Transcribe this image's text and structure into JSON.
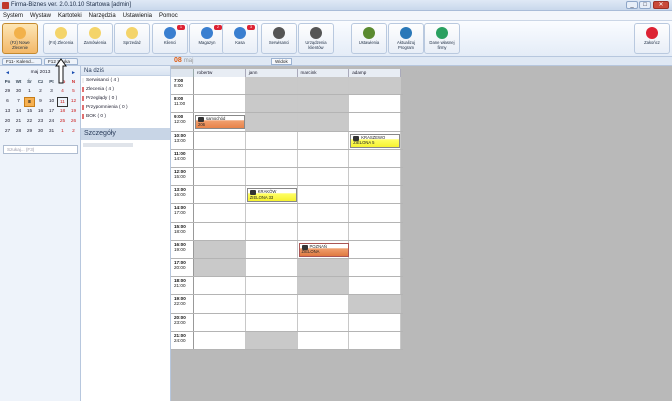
{
  "window": {
    "title": "Firma-Biznes ver. 2.0.10.10 Startowa [admin]",
    "min": "_",
    "max": "□",
    "close": "✕"
  },
  "menu": [
    "System",
    "Wystaw",
    "Kartoteki",
    "Narzędzia",
    "Ustawienia",
    "Pomoc"
  ],
  "toolbar": {
    "buttons": [
      {
        "label": "(F2) Nowe Zlecenie",
        "icon": "new-order-icon",
        "color": "#f2b14a"
      },
      {
        "label": "(F4) Zlecenia",
        "icon": "orders-icon",
        "color": "#f4d46a"
      },
      {
        "label": "Zamówienia",
        "icon": "purchase-icon",
        "color": "#f4d46a"
      },
      {
        "label": "Sprzedaż",
        "icon": "sales-icon",
        "color": "#f4d46a"
      },
      {
        "label": "Klienci",
        "icon": "clients-icon",
        "color": "#3a7fd0"
      },
      {
        "label": "Magazyn",
        "icon": "warehouse-icon",
        "color": "#3a7fd0"
      },
      {
        "label": "Kasa",
        "icon": "cash-icon",
        "color": "#3a7fd0"
      },
      {
        "label": "Serwisanci",
        "icon": "technicians-icon",
        "color": "#555"
      },
      {
        "label": "Urządzenia klientów",
        "icon": "devices-icon",
        "color": "#555"
      },
      {
        "label": "Ustawienia",
        "icon": "settings-icon",
        "color": "#5a8a30"
      },
      {
        "label": "Aktualizuj Program",
        "icon": "update-icon",
        "color": "#2a78b8"
      },
      {
        "label": "Dane własnej firmy",
        "icon": "company-icon",
        "color": "#2aa060"
      },
      {
        "label": "Zakończ",
        "icon": "exit-icon",
        "color": "#d23"
      }
    ],
    "badges": [
      "1",
      "2",
      "3"
    ]
  },
  "tabs": {
    "calendar": "F11- Kalend...",
    "search": "F12 Szuka",
    "date": "08",
    "month": "maj",
    "widok": "Widok"
  },
  "calendar": {
    "month_year": "maj 2013",
    "prev": "◄",
    "next": "►",
    "day_names": [
      "Pn",
      "Wt",
      "Śr",
      "Cz",
      "Pt",
      "So",
      "N"
    ],
    "days": [
      "29",
      "30",
      "1",
      "2",
      "3",
      "4",
      "5",
      "6",
      "7",
      "8",
      "9",
      "10",
      "11",
      "12",
      "13",
      "14",
      "15",
      "16",
      "17",
      "18",
      "19",
      "20",
      "21",
      "22",
      "23",
      "24",
      "25",
      "26",
      "27",
      "28",
      "29",
      "30",
      "31",
      "1",
      "2"
    ],
    "today": "8"
  },
  "search": {
    "placeholder": "Szukaj... (F3)"
  },
  "stats": {
    "title": "Na dziś",
    "items": [
      {
        "label": "Serwisanci ( 4 )",
        "color": "#f0f0f0"
      },
      {
        "label": "Zlecenia ( 4 )",
        "color": "#e07070"
      },
      {
        "label": "Przeglądy ( 0 )",
        "color": "#e07070"
      },
      {
        "label": "Przypomnienia ( 0 )",
        "color": "#e07070"
      },
      {
        "label": "BOK ( 0 )",
        "color": "#e07070"
      }
    ],
    "details": "Szczegóły"
  },
  "schedule": {
    "technicians": [
      "robertw",
      "jann",
      "marcink",
      "adamp"
    ],
    "hours": [
      {
        "start": "7:00",
        "end": "8:00",
        "off": [
          1,
          2,
          3
        ]
      },
      {
        "start": "8:00",
        "end": "11:00",
        "off": [
          1,
          2
        ]
      },
      {
        "start": "9:00",
        "end": "12:00",
        "off": [
          1,
          2
        ]
      },
      {
        "start": "10:00",
        "end": "13:00",
        "off": []
      },
      {
        "start": "11:00",
        "end": "14:00",
        "off": []
      },
      {
        "start": "12:00",
        "end": "15:00",
        "off": []
      },
      {
        "start": "13:00",
        "end": "16:00",
        "off": []
      },
      {
        "start": "14:00",
        "end": "17:00",
        "off": []
      },
      {
        "start": "15:00",
        "end": "18:00",
        "off": []
      },
      {
        "start": "16:00",
        "end": "19:00",
        "off": [
          0
        ]
      },
      {
        "start": "17:00",
        "end": "20:00",
        "off": [
          0,
          2
        ]
      },
      {
        "start": "18:00",
        "end": "21:00",
        "off": [
          2
        ]
      },
      {
        "start": "19:00",
        "end": "22:00",
        "off": [
          3
        ]
      },
      {
        "start": "20:00",
        "end": "23:00",
        "off": []
      },
      {
        "start": "21:00",
        "end": "24:00",
        "off": [
          1
        ]
      }
    ],
    "appointments": [
      {
        "text1": "samochód",
        "text2": "206",
        "col": 0,
        "row": 2,
        "style": "orange"
      },
      {
        "text1": "KRASZEWO",
        "text2": "ZIELONA 5",
        "col": 3,
        "row": 3,
        "style": "yellow"
      },
      {
        "text1": "KRAKÓW",
        "text2": "ZIELONA 33",
        "col": 1,
        "row": 6,
        "style": "yellow"
      },
      {
        "text1": "POZNAŃ",
        "text2": "ZIELONA",
        "col": 2,
        "row": 9,
        "style": "orange-dark"
      }
    ]
  }
}
